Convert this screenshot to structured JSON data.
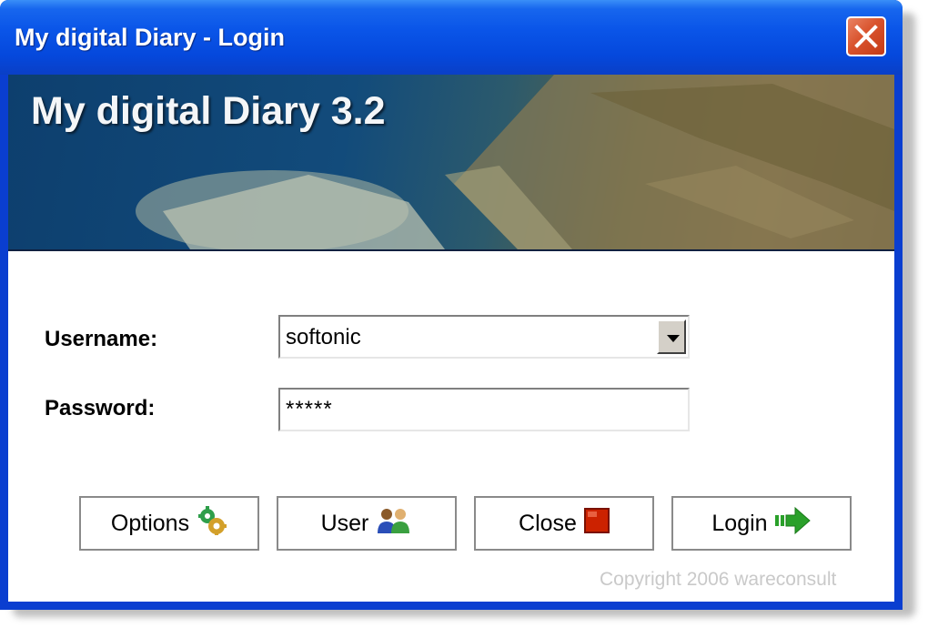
{
  "window": {
    "title": "My digital Diary - Login",
    "close_icon": "close-x-icon"
  },
  "banner": {
    "title": "My digital Diary 3.2"
  },
  "form": {
    "username_label": "Username:",
    "username_value": "softonic",
    "password_label": "Password:",
    "password_value": "*****"
  },
  "buttons": {
    "options": "Options",
    "user": "User",
    "close": "Close",
    "login": "Login"
  },
  "footer": {
    "copyright": "Copyright 2006 wareconsult"
  },
  "colors": {
    "titlebar": "#0a55e8",
    "close_button": "#d9532d",
    "close_icon": "#cc2200",
    "login_arrow": "#2aa02a"
  }
}
